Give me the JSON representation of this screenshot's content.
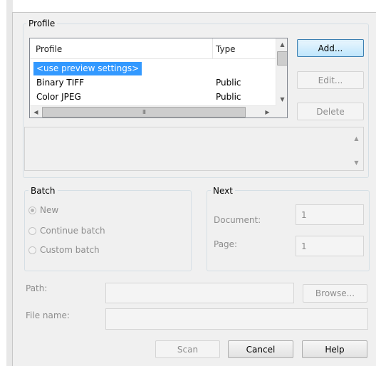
{
  "profile_group": {
    "title": "Profile",
    "columns": [
      "Profile",
      "Type"
    ],
    "rows": [
      {
        "name": "<use preview settings>",
        "type": "",
        "selected": true
      },
      {
        "name": "Binary TIFF",
        "type": "Public",
        "selected": false
      },
      {
        "name": "Color JPEG",
        "type": "Public",
        "selected": false
      }
    ],
    "hscroll_grip": "III",
    "buttons": {
      "add": "Add...",
      "edit": "Edit...",
      "delete": "Delete"
    }
  },
  "batch_group": {
    "title": "Batch",
    "options": [
      {
        "label": "New",
        "checked": true
      },
      {
        "label": "Continue batch",
        "checked": false
      },
      {
        "label": "Custom batch",
        "checked": false
      }
    ]
  },
  "next_group": {
    "title": "Next",
    "document_label": "Document:",
    "document_value": "1",
    "page_label": "Page:",
    "page_value": "1"
  },
  "path": {
    "label": "Path:",
    "value": "",
    "browse_label": "Browse..."
  },
  "file_name": {
    "label": "File name:",
    "value": ""
  },
  "footer": {
    "scan_label": "Scan",
    "cancel_label": "Cancel",
    "help_label": "Help"
  },
  "colors": {
    "selection": "#3399ff",
    "dialog_bg": "#f0f0f0",
    "default_button_border": "#3c7fb1"
  },
  "icons": [
    "arrow-up-icon",
    "arrow-down-icon",
    "arrow-left-icon",
    "arrow-right-icon"
  ]
}
